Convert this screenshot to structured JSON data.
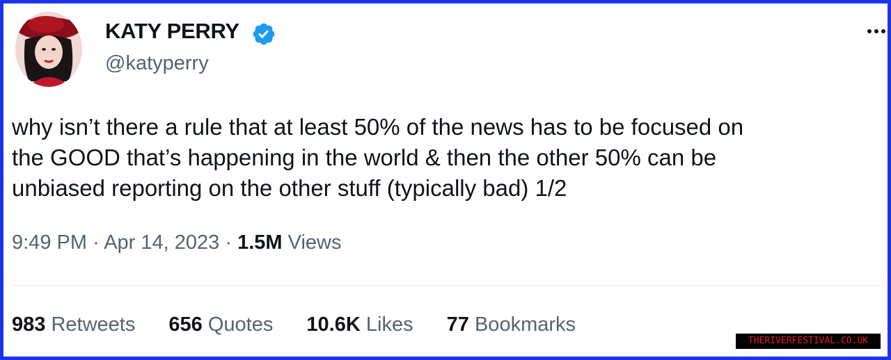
{
  "author": {
    "display_name": "KATY PERRY",
    "handle": "@katyperry",
    "verified": true,
    "avatar_icon": "profile-photo"
  },
  "tweet": {
    "text_lines": [
      "why isn’t there a rule that at least 50% of the news has to be focused on",
      "the GOOD that’s happening in the world & then the other 50% can be",
      "unbiased reporting on the other stuff (typically bad) 1/2"
    ],
    "time": "9:49 PM",
    "separator": "·",
    "date": "Apr 14, 2023",
    "views_count": "1.5M",
    "views_label": "Views"
  },
  "stats": [
    {
      "count": "983",
      "label": "Retweets"
    },
    {
      "count": "656",
      "label": "Quotes"
    },
    {
      "count": "10.6K",
      "label": "Likes"
    },
    {
      "count": "77",
      "label": "Bookmarks"
    }
  ],
  "watermark": "THERIVERFESTIVAL.CO.UK",
  "colors": {
    "frame_border": "#1d35e8",
    "verified_badge": "#1d9bf0",
    "text_primary": "#0f1419",
    "text_secondary": "#536471",
    "watermark_bg": "#000000",
    "watermark_text": "#e02020"
  },
  "icons": {
    "verified": "verified-badge-icon",
    "more": "more-options-icon"
  }
}
